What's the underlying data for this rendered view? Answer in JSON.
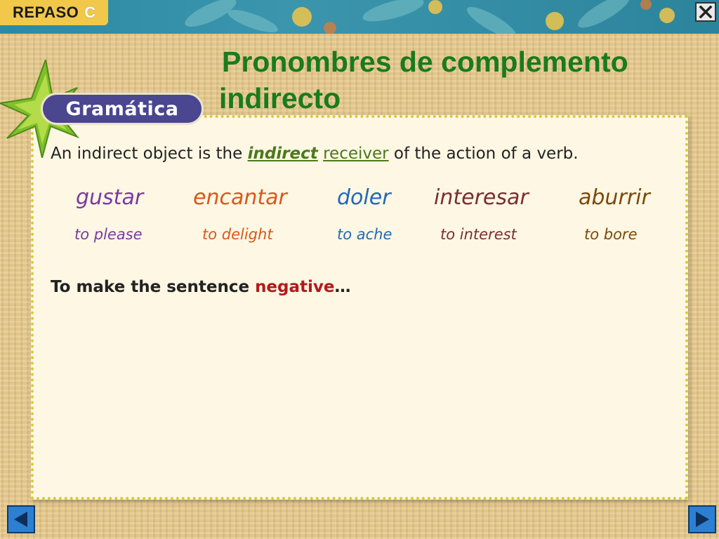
{
  "header": {
    "label": "REPASO",
    "letter": "C"
  },
  "title": {
    "line1": "Pronombres de complemento",
    "line2": "indirecto"
  },
  "badge": {
    "text": "Gramática"
  },
  "intro": {
    "before": "An indirect object is the ",
    "highlight1": "indirect",
    "highlight2": "receiver",
    "after": " of the action of a verb."
  },
  "verbs": [
    {
      "word": "gustar",
      "translation": "to please",
      "color": "#7a3aa0"
    },
    {
      "word": "encantar",
      "translation": "to delight",
      "color": "#d8581a"
    },
    {
      "word": "doler",
      "translation": "to ache",
      "color": "#2468b4"
    },
    {
      "word": "interesar",
      "translation": "to interest",
      "color": "#7a2e2e"
    },
    {
      "word": "aburrir",
      "translation": "to bore",
      "color": "#7a4a0a"
    }
  ],
  "negative": {
    "before": "To make the sentence ",
    "word": "negative",
    "after": "…"
  },
  "icons": {
    "close": "close-icon",
    "prev": "arrow-left-icon",
    "next": "arrow-right-icon"
  },
  "colors": {
    "title": "#1a7a1e",
    "badge": "#4a4690",
    "negative": "#b11a1a",
    "banner": "#2d8aa3",
    "nav": "#2d7fd2"
  }
}
